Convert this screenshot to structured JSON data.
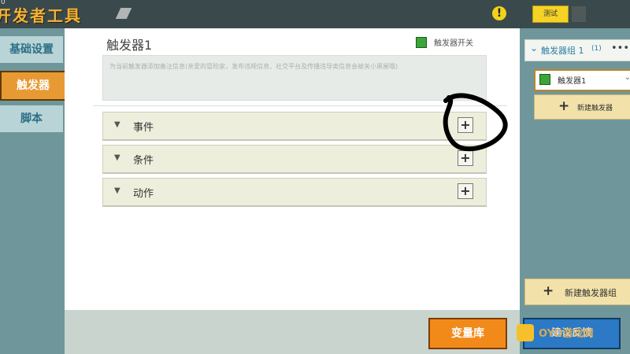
{
  "header": {
    "title": "开发者工具",
    "tiny_label": "0",
    "warning_icon": "warning-icon",
    "warning_glyph": "!",
    "test_label": "测试"
  },
  "sidebar": {
    "items": [
      {
        "label": "基础设置"
      },
      {
        "label": "触发器"
      },
      {
        "label": "脚本"
      }
    ]
  },
  "main": {
    "title": "触发器1",
    "switch_label": "触发器开关",
    "note_placeholder": "为当前触发器添加备注信息(亲爱的冒险家，发布违规信息、社交平台及传播违导类信息会被关小黑屋哦)",
    "sections": [
      {
        "label": "事件"
      },
      {
        "label": "条件"
      },
      {
        "label": "动作"
      }
    ]
  },
  "right_panel": {
    "group_label": "触发器组 1",
    "group_count": "(1)",
    "trigger_item_label": "触发器1",
    "new_trigger_label": "新建触发器",
    "new_group_label": "新建触发器组"
  },
  "footer": {
    "variable_button": "变量库",
    "right_button": "建议反馈",
    "watermark": "OYO游戏网"
  },
  "icons": {
    "plus": "+",
    "triangle": "▼",
    "dots": "•••",
    "chevron": "⌄"
  },
  "colors": {
    "accent_orange": "#e79a33",
    "accent_yellow": "#f5d226",
    "panel_teal": "#6f979b",
    "link_blue": "#2e7ea3"
  }
}
